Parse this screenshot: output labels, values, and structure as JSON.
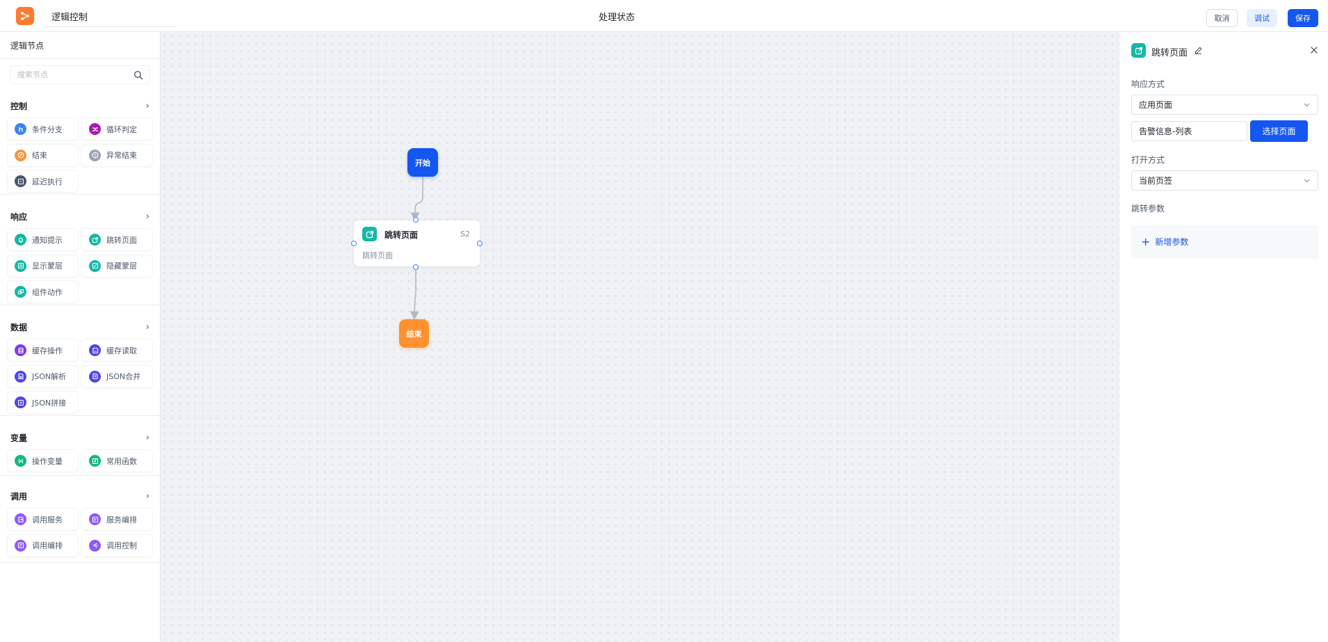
{
  "header": {
    "flow_name": "逻辑控制",
    "center_title": "处理状态",
    "buttons": {
      "cancel": "取消",
      "debug": "调试",
      "save": "保存"
    }
  },
  "sidebar": {
    "title": "逻辑节点",
    "search_placeholder": "搜索节点",
    "groups": [
      {
        "title": "控制",
        "items": [
          {
            "label": "条件分支",
            "icon": "branch-icon",
            "color": "#3b82f6"
          },
          {
            "label": "循环判定",
            "icon": "shuffle-icon",
            "color": "#a21caf"
          },
          {
            "label": "结束",
            "icon": "stop-icon",
            "color": "#fb923c"
          },
          {
            "label": "异常结束",
            "icon": "alert-icon",
            "color": "#9ca3af"
          },
          {
            "label": "延迟执行",
            "icon": "timer-icon",
            "color": "#475569"
          }
        ]
      },
      {
        "title": "响应",
        "items": [
          {
            "label": "通知提示",
            "icon": "bell-icon",
            "color": "#14b8a6"
          },
          {
            "label": "跳转页面",
            "icon": "external-link-icon",
            "color": "#14b8a6"
          },
          {
            "label": "显示蒙层",
            "icon": "layer-show-icon",
            "color": "#14b8a6"
          },
          {
            "label": "隐藏蒙层",
            "icon": "layer-hide-icon",
            "color": "#14b8a6"
          },
          {
            "label": "组件动作",
            "icon": "component-icon",
            "color": "#14b8a6"
          }
        ]
      },
      {
        "title": "数据",
        "items": [
          {
            "label": "缓存操作",
            "icon": "database-icon",
            "color": "#7c3aed"
          },
          {
            "label": "缓存读取",
            "icon": "save-icon",
            "color": "#4f46e5"
          },
          {
            "label": "JSON解析",
            "icon": "json-parse-icon",
            "color": "#4f46e5"
          },
          {
            "label": "JSON合并",
            "icon": "json-merge-icon",
            "color": "#4f46e5"
          },
          {
            "label": "JSON拼接",
            "icon": "json-concat-icon",
            "color": "#4f46e5"
          }
        ]
      },
      {
        "title": "变量",
        "items": [
          {
            "label": "操作变量",
            "icon": "variable-icon",
            "color": "#10b981"
          },
          {
            "label": "常用函数",
            "icon": "function-icon",
            "color": "#10b981"
          }
        ]
      },
      {
        "title": "调用",
        "items": [
          {
            "label": "调用服务",
            "icon": "service-icon",
            "color": "#8b5cf6"
          },
          {
            "label": "服务编排",
            "icon": "orchestrate-icon",
            "color": "#8b5cf6"
          },
          {
            "label": "调用编排",
            "icon": "call-orchestrate-icon",
            "color": "#8b5cf6"
          },
          {
            "label": "调用控制",
            "icon": "call-control-icon",
            "color": "#8b5cf6"
          }
        ]
      }
    ]
  },
  "canvas": {
    "start_node": "开始",
    "end_node": "结束",
    "jump_node": {
      "title": "跳转页面",
      "code": "S2",
      "subtitle": "跳转页面"
    }
  },
  "properties": {
    "title": "跳转页面",
    "response_mode_label": "响应方式",
    "response_mode_value": "应用页面",
    "page_value": "告警信息-列表",
    "select_page_button": "选择页面",
    "open_mode_label": "打开方式",
    "open_mode_value": "当前页签",
    "params_label": "跳转参数",
    "add_param_label": "新增参数"
  },
  "colors": {
    "primary": "#1456f0",
    "start": "#1456f0",
    "end": "#ff922f",
    "jump": "#14b8a6"
  }
}
